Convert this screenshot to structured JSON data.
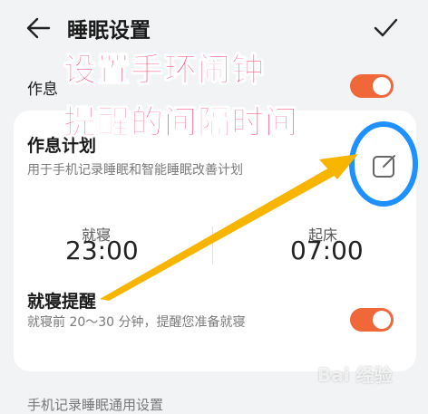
{
  "header": {
    "title": "睡眠设置"
  },
  "settings": {
    "zuoxi_label": "作息"
  },
  "schedule": {
    "title": "作息计划",
    "desc": "用于手机记录睡眠和智能睡眠改善计划",
    "sleep_label": "就寝",
    "sleep_time": "23:00",
    "wake_label": "起床",
    "wake_time": "07:00"
  },
  "reminder": {
    "title": "就寝提醒",
    "desc": "就寝前 20～30 分钟，提醒您准备就寝"
  },
  "bottom": {
    "text": "手机记录睡眠通用设置"
  },
  "overlay": {
    "line1": "设置手环闹钟",
    "line2": "提醒的间隔时间"
  },
  "watermark": {
    "text": "Bai 经验"
  },
  "colors": {
    "toggle_on": "#f0683a",
    "overlay_text": "#ff2b62",
    "arrow": "#f7b500",
    "circle": "#1e90ff"
  },
  "icons": {
    "back": "back-arrow-icon",
    "confirm": "check-icon",
    "edit": "edit-icon"
  }
}
